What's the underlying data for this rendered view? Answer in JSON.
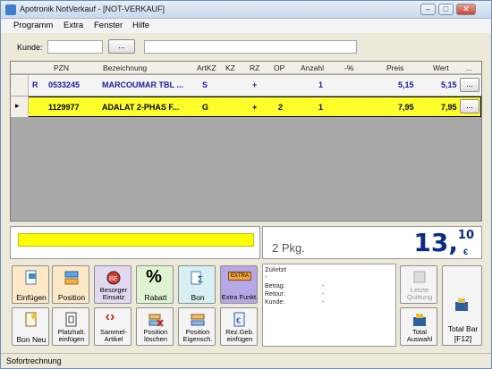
{
  "window": {
    "title": "Apotronik NotVerkauf - [NOT-VERKAUF]"
  },
  "menu": [
    "Programm",
    "Extra",
    "Fenster",
    "Hilfe"
  ],
  "kunde": {
    "label": "Kunde:",
    "value": "",
    "button_label": "...",
    "name_value": ""
  },
  "grid": {
    "headers": [
      "PZN",
      "Bezeichnung",
      "ArtKZ",
      "KZ",
      "RZ",
      "OP",
      "Anzahl",
      "-%",
      "Preis",
      "Wert",
      "..."
    ],
    "rows": [
      {
        "indicator": "",
        "flag": "R",
        "pzn": "0533245",
        "bezeichnung": "MARCOUMAR TBL ...",
        "artkz": "S",
        "kz": "",
        "rz": "+",
        "op": "",
        "anzahl": "1",
        "rabatt": "",
        "preis": "5,15",
        "wert": "5,15",
        "more": "..."
      },
      {
        "indicator": "▸",
        "flag": "",
        "pzn": "1129977",
        "bezeichnung": "ADALAT 2-PHAS F...",
        "artkz": "G",
        "kz": "",
        "rz": "+",
        "op": "2",
        "anzahl": "1",
        "rabatt": "",
        "preis": "7,95",
        "wert": "7,95",
        "more": "..."
      }
    ]
  },
  "total": {
    "packages": "2 Pkg.",
    "amount_main": "13,",
    "amount_decimal": "10",
    "currency": "€"
  },
  "toolbar_row1": [
    {
      "label": "Einfügen",
      "icon": "insert-icon"
    },
    {
      "label": "Position",
      "icon": "position-icon"
    },
    {
      "label": "Besorger Einsatz",
      "icon": "besorger-icon"
    },
    {
      "label": "Rabatt",
      "icon": "percent-icon"
    },
    {
      "label": "Bon",
      "icon": "bon-sum-icon"
    },
    {
      "label": "Extra Funkt.",
      "icon": "extra-icon",
      "badge": "EXTRA"
    }
  ],
  "toolbar_row2": [
    {
      "label": "Bon Neu",
      "icon": "new-bon-icon"
    },
    {
      "label": "Platzhalt. einfügen",
      "icon": "placeholder-icon"
    },
    {
      "label": "Sammel-Artikel",
      "icon": "collect-icon"
    },
    {
      "label": "Position löschen",
      "icon": "delete-position-icon"
    },
    {
      "label": "Position Eigensch.",
      "icon": "position-props-icon"
    },
    {
      "label": "Rez.Geb. einfügen",
      "icon": "rezgeb-icon"
    }
  ],
  "zuletzt": {
    "title": "Zuletzt",
    "dash": "-",
    "lines": [
      {
        "label": "Betrag:",
        "value": "-"
      },
      {
        "label": "Retour:",
        "value": "-"
      },
      {
        "label": "Kunde:",
        "value": "-"
      }
    ]
  },
  "right_buttons": {
    "letzte_quittung": "Letzte Quittung",
    "total_auswahl": "Total Auswahl",
    "total_bar": "Total Bar",
    "total_bar_key": "[F12]"
  },
  "status": {
    "text": "Sofortrechnung"
  },
  "colors": {
    "row_highlight": "#ffff2a",
    "total_blue": "#0b2c86",
    "yellow_bar": "#ffff00"
  }
}
